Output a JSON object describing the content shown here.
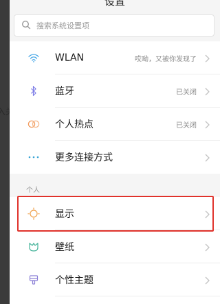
{
  "header": {
    "title": "设置"
  },
  "background": {
    "fragment": "入关"
  },
  "search": {
    "placeholder": "搜索系统设置项"
  },
  "network": {
    "items": [
      {
        "label": "WLAN",
        "status": "哎呦，又被你发现了",
        "icon": "wifi-icon",
        "color": "#4aa9e8"
      },
      {
        "label": "蓝牙",
        "status": "已关闭",
        "icon": "bluetooth-icon",
        "color": "#7b7be6"
      },
      {
        "label": "个人热点",
        "status": "已关闭",
        "icon": "hotspot-icon",
        "color": "#f29a5c"
      },
      {
        "label": "更多连接方式",
        "status": "",
        "icon": "more-connections-icon",
        "color": "#3aa5d6"
      }
    ]
  },
  "personal": {
    "section_label": "个人",
    "items": [
      {
        "label": "显示",
        "icon": "brightness-icon",
        "color": "#f0a24e",
        "highlighted": true
      },
      {
        "label": "壁纸",
        "icon": "wallpaper-icon",
        "color": "#45b39a"
      },
      {
        "label": "个性主题",
        "icon": "theme-icon",
        "color": "#8b7fd6"
      }
    ]
  },
  "colors": {
    "highlight": "#e0322b",
    "panel": "#f5f5f5"
  }
}
